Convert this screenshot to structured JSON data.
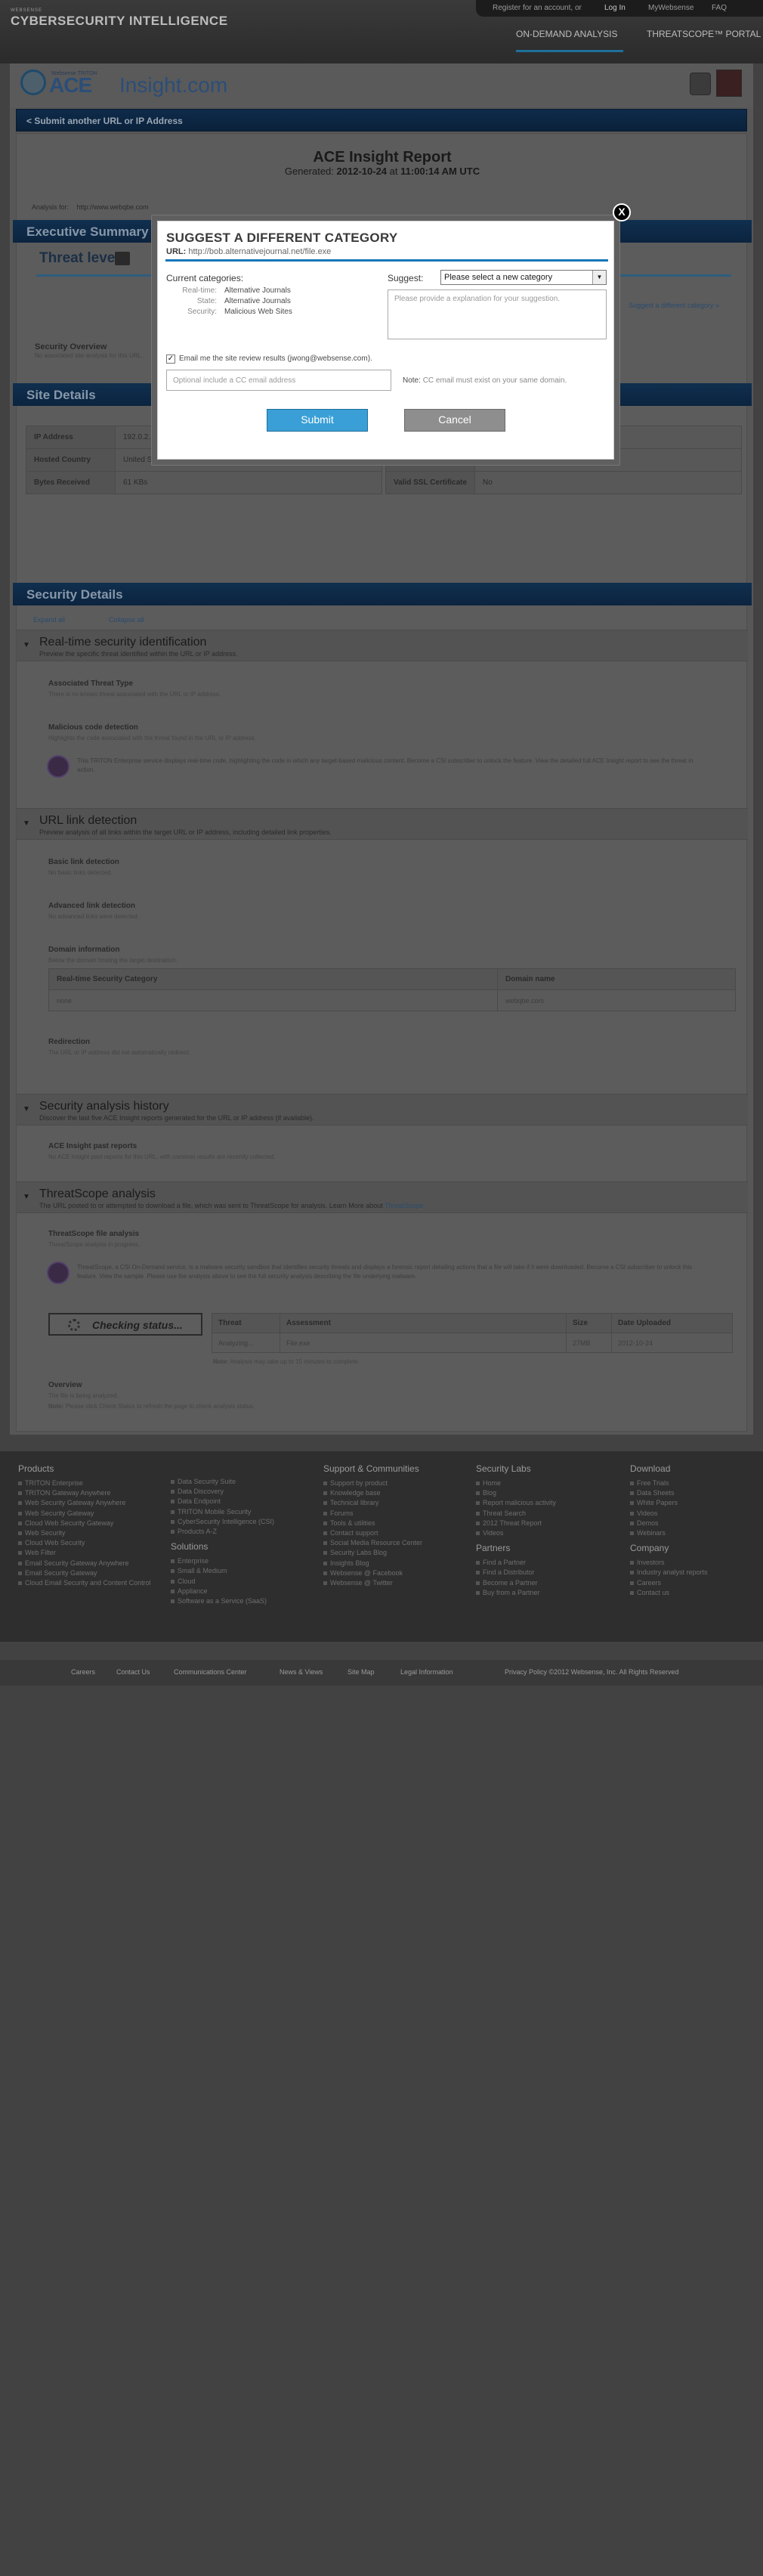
{
  "header": {
    "brand_small": "WEBSENSE",
    "brand": "CYBERSECURITY INTELLIGENCE",
    "account_prompt": "Register for an account, or",
    "login": "Log In",
    "mywebsense": "MyWebsense",
    "faq": "FAQ",
    "nav": [
      "ON-DEMAND ANALYSIS",
      "THREATSCOPE™ PORTAL"
    ]
  },
  "logo": {
    "tagline": "Websense TRITON",
    "name_ace": "ACE",
    "name_insight": "Insight.com"
  },
  "back_link": "< Submit another URL or IP Address",
  "report": {
    "title": "ACE Insight Report",
    "generated_label": "Generated:",
    "generated_date": "2012-10-24",
    "at_label": "at",
    "generated_time": "11:00:14 AM UTC",
    "analysis_for_label": "Analysis for:",
    "analysis_for": "http://www.webqbe.com"
  },
  "sections": {
    "executive": "Executive Summary",
    "threat_level": "Threat level:",
    "suggest_link": "Suggest a different category »",
    "security_overview": "Security Overview",
    "security_overview_sub": "No associated site analysis for this URL.",
    "site_details": "Site Details",
    "security_details": "Security Details"
  },
  "site_details": {
    "left": [
      {
        "k": "IP Address",
        "v": "192.0.2.15"
      },
      {
        "k": "Hosted Country",
        "v": "United States"
      },
      {
        "k": "Bytes Received",
        "v": "61 KBs"
      }
    ],
    "right": [
      {
        "k": "",
        "v": ""
      },
      {
        "k": "",
        "v": ""
      },
      {
        "k": "Valid SSL Certificate",
        "v": "No"
      }
    ]
  },
  "security": {
    "expand_all": "Expand all",
    "collapse_all": "Collapse all",
    "groups": [
      {
        "title": "Real-time security identification",
        "sub": "Preview the specific threat identified within the URL or IP address."
      },
      {
        "title": "URL link detection",
        "sub": "Preview analysis of all links within the target URL or IP address, including detailed link properties."
      },
      {
        "title": "Security analysis history",
        "sub": "Discover the last five ACE Insight reports generated for the URL or IP address (if available)."
      },
      {
        "title": "ThreatScope analysis",
        "sub": "The URL posted to or attempted to download a file, which was sent to ThreatScope for analysis. Learn More about",
        "sub_link": "ThreatScope"
      }
    ],
    "items": {
      "assoc_threat": "Associated Threat Type",
      "assoc_threat_sub": "There is no known threat associated with the URL or IP address.",
      "malicious": "Malicious code detection",
      "malicious_sub": "Highlights the code associated with the threat found in the URL or IP address.",
      "lock_text": "This TRITON Enterprise service displays real-time code, highlighting the code in which any target-based malicious content. Become a CSI subscriber to unlock the feature. View the detailed full ACE Insight report to see the threat in action.",
      "basic": "Basic link detection",
      "basic_sub": "No basic links detected.",
      "advanced": "Advanced link detection",
      "advanced_sub": "No advanced links were detected.",
      "domain": "Domain information",
      "domain_sub": "Below the domain hosting the target destination.",
      "redirection": "Redirection",
      "redirection_sub": "The URL or IP address did not automatically redirect.",
      "ace_past": "ACE Insight past reports",
      "ace_past_sub": "No ACE Insight past reports for this URL, with common results are recently collected.",
      "ts_file": "ThreatScope file analysis",
      "ts_file_sub": "ThreatScope analysis in progress.",
      "ts_lock_text": "ThreatScope, a CSI On-Demand service, is a malware security sandbox that identifies security threats and displays a forensic report detailing actions that a file will take if it were downloaded. Become a CSI subscriber to unlock this feature. View the sample. Please use the analysis above to see the full security analysis describing the file underlying malware.",
      "overview": "Overview",
      "overview_sub": "The file is being analyzed.",
      "note_label": "Note:",
      "note": "Please click Check Status to refresh the page to check analysis status.",
      "ts_note_label": "Note:",
      "ts_note": "Analysis may take up to 15 minutes to complete."
    },
    "domain_table": {
      "headers": [
        "Real-time Security Category",
        "Domain name"
      ],
      "row": [
        "none",
        "webqbe.com"
      ]
    },
    "checking": "Checking status...",
    "ts_table": {
      "headers": [
        "Threat",
        "Assessment",
        "Size",
        "Date Uploaded"
      ],
      "row": [
        "Analyzing...",
        "File.exe",
        "27MB",
        "2012-10-24"
      ]
    }
  },
  "footer": {
    "cols": [
      {
        "title": "Products",
        "items": [
          "TRITON Enterprise",
          "TRITON Gateway Anywhere",
          "Web Security Gateway Anywhere",
          "Web Security Gateway",
          "Cloud Web Security Gateway",
          "Web Security",
          "Cloud Web Security",
          "Web Filter",
          "Email Security Gateway Anywhere",
          "Email Security Gateway",
          "Cloud Email Security and Content Control"
        ]
      },
      {
        "title": "",
        "items": [
          "Data Security Suite",
          "Data Discovery",
          "Data Endpoint",
          "TRITON Mobile Security",
          "CyberSecurity Intelligence (CSI)",
          "Products A-Z"
        ],
        "title2": "Solutions",
        "items2": [
          "Enterprise",
          "Small & Medium",
          "Cloud",
          "Appliance",
          "Software as a Service (SaaS)"
        ]
      },
      {
        "title": "Support & Communities",
        "items": [
          "Support by product",
          "Knowledge base",
          "Technical library",
          "Forums",
          "Tools & utilities",
          "Contact support",
          "Social Media Resource Center",
          "Security Labs Blog",
          "Insights Blog",
          "Websense @ Facebook",
          "Websense @ Twitter"
        ]
      },
      {
        "title": "Security Labs",
        "items": [
          "Home",
          "Blog",
          "Report malicious activity",
          "Threat Search",
          "2012 Threat Report",
          "Videos"
        ],
        "title2": "Partners",
        "items2": [
          "Find a Partner",
          "Find a Distributor",
          "Become a Partner",
          "Buy from a Partner"
        ]
      },
      {
        "title": "Download",
        "items": [
          "Free Trials",
          "Data Sheets",
          "White Papers",
          "Videos",
          "Demos",
          "Webinars"
        ],
        "title2": "Company",
        "items2": [
          "Investors",
          "Industry analyst reports",
          "Careers",
          "Contact us"
        ]
      }
    ],
    "bottom_links": [
      "Careers",
      "Contact Us",
      "Communications Center",
      "News & Views",
      "Site Map",
      "Legal Information"
    ],
    "copyright": "Privacy Policy ©2012 Websense, Inc. All Rights Reserved"
  },
  "modal": {
    "close": "X",
    "title": "SUGGEST A DIFFERENT CATEGORY",
    "url_label": "URL:",
    "url": "http://bob.alternativejournal.net/file.exe",
    "current_label": "Current categories:",
    "current": [
      {
        "k": "Real-time:",
        "v": "Alternative Journals"
      },
      {
        "k": "State:",
        "v": "Alternative Journals"
      },
      {
        "k": "Security:",
        "v": "Malicious Web Sites"
      }
    ],
    "suggest_label": "Suggest:",
    "select_value": "Please select a new category",
    "textarea_placeholder": "Please provide a explanation for your suggestion.",
    "email_label": "Email me the site review results (jwong@websense.com).",
    "cc_placeholder": "Optional include a CC email address",
    "note_label": "Note:",
    "note": "CC email must exist on your same domain.",
    "submit": "Submit",
    "cancel": "Cancel"
  }
}
